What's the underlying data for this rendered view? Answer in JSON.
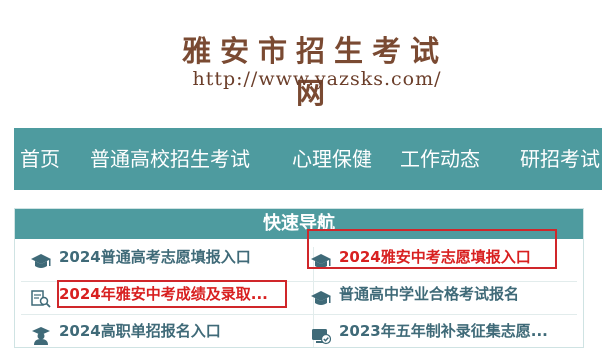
{
  "site": {
    "title": "雅安市招生考试网",
    "url": "http://www.yazsks.com/"
  },
  "nav": {
    "items": [
      "首页",
      "普通高校招生考试",
      "心理保健",
      "工作动态",
      "研招考试"
    ]
  },
  "quick": {
    "heading": "快速导航",
    "links": [
      {
        "label": "2024普通高考志愿填报入口",
        "icon": "graduation-cap-icon",
        "highlight": false
      },
      {
        "label": "2024雅安中考志愿填报入口",
        "icon": "graduation-cap-icon",
        "highlight": true
      },
      {
        "label": "2024年雅安中考成绩及录取...",
        "icon": "search-document-icon",
        "highlight": true
      },
      {
        "label": "普通高中学业合格考试报名",
        "icon": "graduation-cap-icon",
        "highlight": false
      },
      {
        "label": "2024高职单招报名入口",
        "icon": "student-icon",
        "highlight": false
      },
      {
        "label": "2023年五年制补录征集志愿...",
        "icon": "check-device-icon",
        "highlight": false
      }
    ]
  },
  "colors": {
    "nav_bg": "#4e9b9f",
    "link": "#3f6a78",
    "highlight": "#d82020",
    "logo": "#7a4a32"
  }
}
